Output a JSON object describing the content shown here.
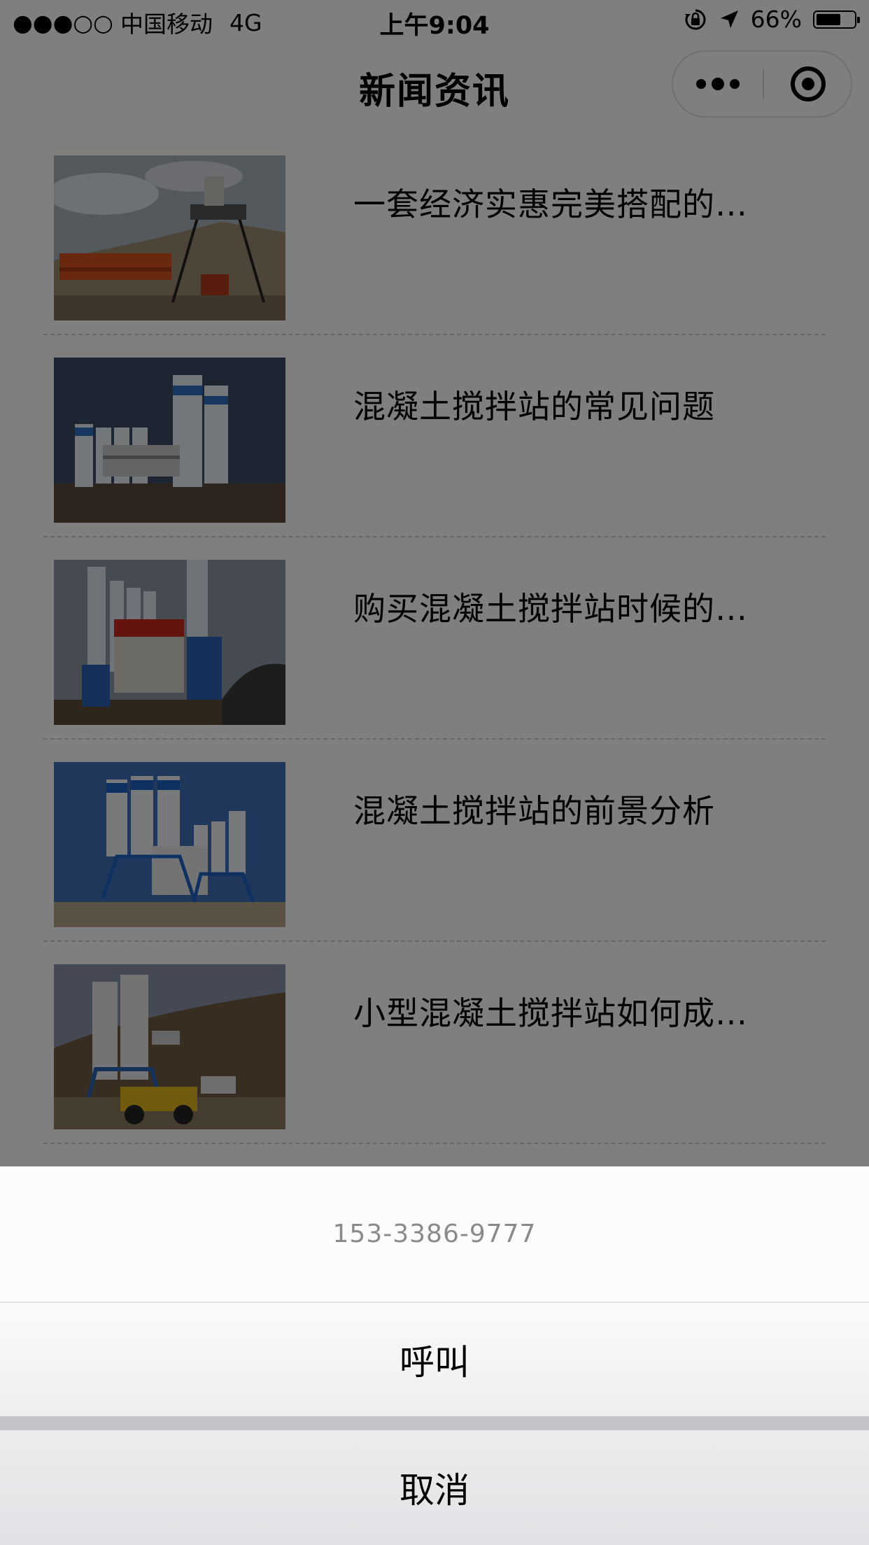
{
  "status_bar": {
    "signal": "●●●○○",
    "carrier": "中国移动",
    "network": "4G",
    "time": "上午9:04",
    "battery_percent": "66%",
    "battery_level": 0.66,
    "icons": [
      "rotation-lock-icon",
      "location-arrow-icon",
      "battery-icon"
    ]
  },
  "nav": {
    "title": "新闻资讯",
    "more_icon": "more-dots-icon",
    "close_icon": "target-circle-icon"
  },
  "news": [
    {
      "title": "一套经济实惠完美搭配的…",
      "thumbnail": "photo-batching-plant-orange"
    },
    {
      "title": "混凝土搅拌站的常见问题",
      "thumbnail": "photo-silos-blue-white"
    },
    {
      "title": "购买混凝土搅拌站时候的…",
      "thumbnail": "photo-silos-red-banner"
    },
    {
      "title": "混凝土搅拌站的前景分析",
      "thumbnail": "photo-silos-blue-sky"
    },
    {
      "title": "小型混凝土搅拌站如何成…",
      "thumbnail": "photo-silos-hill-loader"
    }
  ],
  "action_sheet": {
    "phone": "153-3386-9777",
    "call_label": "呼叫",
    "cancel_label": "取消"
  }
}
